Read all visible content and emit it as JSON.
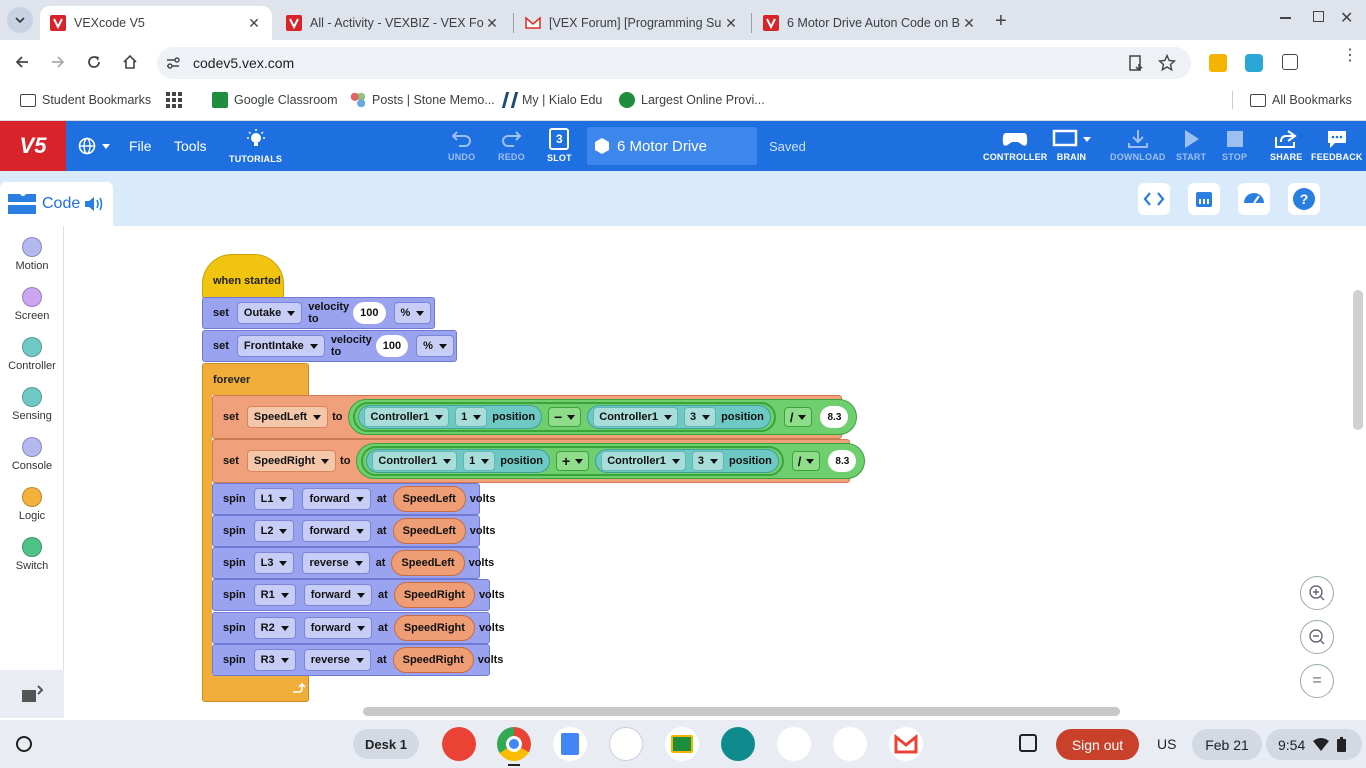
{
  "browser": {
    "tabs": [
      {
        "title": "VEXcode V5",
        "active": true
      },
      {
        "title": "All - Activity - VEXBIZ - VEX For",
        "active": false
      },
      {
        "title": "[VEX Forum] [Programming Su",
        "active": false
      },
      {
        "title": "6 Motor Drive Auton Code on B",
        "active": false
      }
    ],
    "url": "codev5.vex.com",
    "bookmarks": [
      "Student Bookmarks",
      "Google Classroom",
      "Posts | Stone Memo...",
      "My | Kialo Edu",
      "Largest Online Provi...",
      "All Bookmarks"
    ]
  },
  "vex_toolbar": {
    "file": "File",
    "tools": "Tools",
    "tutorials": "TUTORIALS",
    "undo": "UNDO",
    "redo": "REDO",
    "slot": "SLOT",
    "slot_number": "3",
    "project_name": "6 Motor Drive",
    "status": "Saved",
    "controller": "CONTROLLER",
    "brain": "BRAIN",
    "download": "DOWNLOAD",
    "start": "START",
    "stop": "STOP",
    "share": "SHARE",
    "feedback": "FEEDBACK"
  },
  "code_tab": {
    "label": "Code"
  },
  "categories": [
    {
      "label": "Motion",
      "color": "#b3b8f0"
    },
    {
      "label": "Screen",
      "color": "#c9a6ef"
    },
    {
      "label": "Controller",
      "color": "#6ec9c4"
    },
    {
      "label": "Sensing",
      "color": "#6ec9c4"
    },
    {
      "label": "Console",
      "color": "#b3b8f0"
    },
    {
      "label": "Logic",
      "color": "#f4b23d"
    },
    {
      "label": "Switch",
      "color": "#4ec387"
    }
  ],
  "program": {
    "hat": "when started",
    "set1": {
      "kw": "set",
      "motor": "Outake",
      "text": "velocity to",
      "value": "100",
      "unit": "%"
    },
    "set2": {
      "kw": "set",
      "motor": "FrontIntake",
      "text": "velocity to",
      "value": "100",
      "unit": "%"
    },
    "forever": "forever",
    "var1": {
      "kw": "set",
      "var": "SpeedLeft",
      "to": "to",
      "ctrl_a": "Controller1",
      "axis_a": "1",
      "pos": "position",
      "op": "−",
      "ctrl_b": "Controller1",
      "axis_b": "3",
      "div": "/",
      "divisor": "8.3"
    },
    "var2": {
      "kw": "set",
      "var": "SpeedRight",
      "to": "to",
      "ctrl_a": "Controller1",
      "axis_a": "1",
      "pos": "position",
      "op": "+",
      "ctrl_b": "Controller1",
      "axis_b": "3",
      "div": "/",
      "divisor": "8.3"
    },
    "spins": [
      {
        "motor": "L1",
        "dir": "forward",
        "var": "SpeedLeft"
      },
      {
        "motor": "L2",
        "dir": "forward",
        "var": "SpeedLeft"
      },
      {
        "motor": "L3",
        "dir": "reverse",
        "var": "SpeedLeft"
      },
      {
        "motor": "R1",
        "dir": "forward",
        "var": "SpeedRight"
      },
      {
        "motor": "R2",
        "dir": "forward",
        "var": "SpeedRight"
      },
      {
        "motor": "R3",
        "dir": "reverse",
        "var": "SpeedRight"
      }
    ],
    "spin_kw": "spin",
    "at": "at",
    "volts": "volts"
  },
  "zoom": {
    "in": "+",
    "out": "−",
    "reset": "="
  },
  "shelf": {
    "desk": "Desk 1",
    "signout": "Sign out",
    "ime": "US",
    "date": "Feb 21",
    "time": "9:54"
  }
}
